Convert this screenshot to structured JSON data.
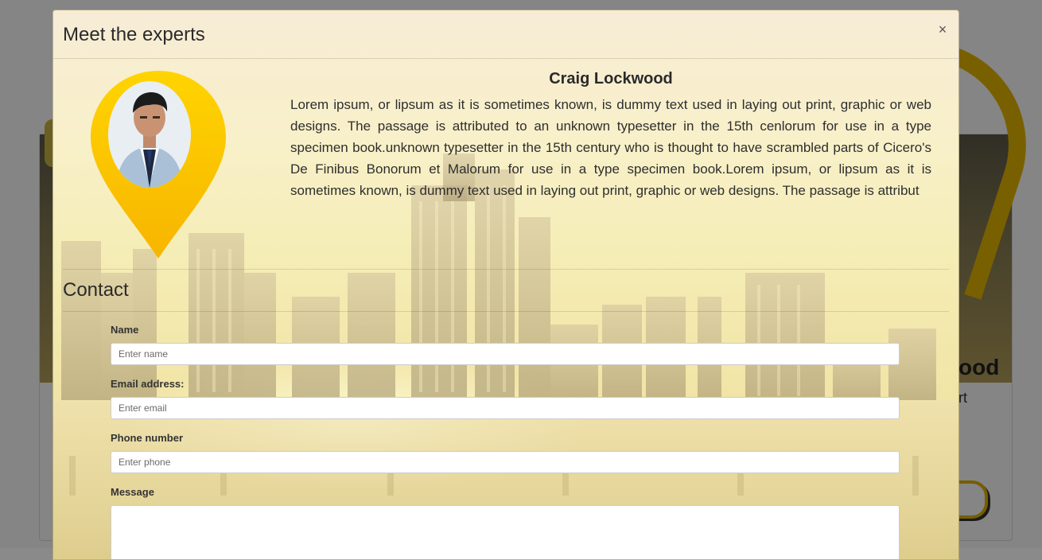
{
  "background": {
    "card_name_fragment": "ood",
    "card_role_fragment": "rt"
  },
  "modal": {
    "title": "Meet the experts",
    "close_glyph": "×"
  },
  "expert": {
    "name": "Craig Lockwood",
    "bio": "Lorem ipsum, or lipsum as it is sometimes known, is dummy text used in laying out print, graphic or web designs. The passage is attributed to an unknown typesetter in the 15th cenlorum for use in a type specimen book.unknown typesetter in the 15th century who is thought to have scrambled parts of Cicero's De Finibus Bonorum et Malorum for use in a type specimen book.Lorem ipsum, or lipsum as it is sometimes known, is dummy text used in laying out print, graphic or web designs. The passage is attribut"
  },
  "contact": {
    "title": "Contact",
    "fields": {
      "name": {
        "label": "Name",
        "placeholder": "Enter name",
        "value": ""
      },
      "email": {
        "label": "Email address:",
        "placeholder": "Enter email",
        "value": ""
      },
      "phone": {
        "label": "Phone number",
        "placeholder": "Enter phone",
        "value": ""
      },
      "message": {
        "label": "Message",
        "placeholder": "",
        "value": ""
      }
    }
  },
  "colors": {
    "pin_yellow": "#ffd400",
    "pin_orange": "#f7b500",
    "accent_gold": "#e6b800"
  },
  "icons": {
    "close": "close-icon",
    "location_pin": "location-pin-icon"
  }
}
